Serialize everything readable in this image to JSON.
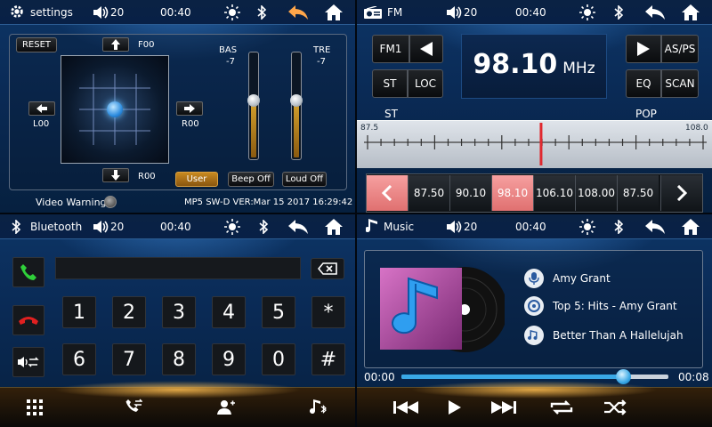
{
  "colors": {
    "accent": "#ffa64a",
    "preset_active": "#f08a8a",
    "needle": "#e0282e",
    "progress": "#39a8e6",
    "user_btn": "#b57a1a"
  },
  "settings": {
    "title": "settings",
    "volume": "20",
    "time": "00:40",
    "reset": "RESET",
    "fade_top": "F00",
    "fade_left": "L00",
    "fade_right": "R00",
    "fade_bottom": "R00",
    "bas_label": "BAS",
    "bas_value": "-7",
    "tre_label": "TRE",
    "tre_value": "-7",
    "bas_level": 0.55,
    "tre_level": 0.55,
    "user": "User",
    "beep": "Beep Off",
    "loud": "Loud Off",
    "video_warning": "Video Warning",
    "version": "MP5 SW-D VER:Mar 15 2017 16:29:42",
    "icons": {
      "back": "back-arrow-icon",
      "home": "home-icon",
      "brightness": "brightness-icon",
      "bluetooth": "bluetooth-icon",
      "volume": "speaker-icon"
    }
  },
  "fm": {
    "title": "FM",
    "volume": "20",
    "time": "00:40",
    "band": "FM1",
    "st": "ST",
    "loc": "LOC",
    "as_ps": "AS/PS",
    "eq": "EQ",
    "scan": "SCAN",
    "frequency": "98.10",
    "unit": "MHz",
    "scale_st": "ST",
    "scale_pop": "POP",
    "scale_min": "87.5",
    "scale_max": "108.0",
    "needle_value": 98.1,
    "range": [
      87.5,
      108.0
    ],
    "presets": [
      "87.50",
      "90.10",
      "98.10",
      "106.10",
      "108.00",
      "87.50"
    ],
    "active_preset": 2
  },
  "bt": {
    "title": "Bluetooth",
    "volume": "20",
    "time": "00:40",
    "keys": [
      "1",
      "2",
      "3",
      "4",
      "5",
      "*",
      "6",
      "7",
      "8",
      "9",
      "0",
      "#"
    ]
  },
  "music": {
    "title": "Music",
    "volume": "20",
    "time": "00:40",
    "artist": "Amy Grant",
    "album": "Top 5: Hits - Amy Grant",
    "song": "Better Than A Hallelujah",
    "elapsed": "00:00",
    "duration": "00:08",
    "progress": 0.83
  }
}
